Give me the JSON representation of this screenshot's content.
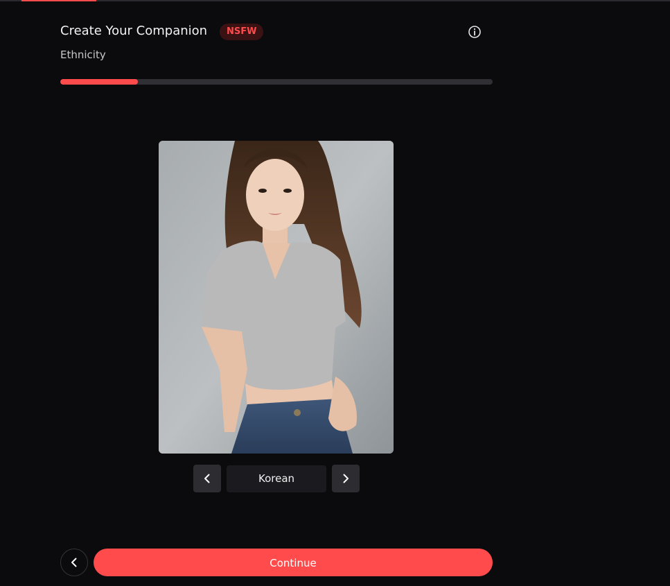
{
  "header": {
    "title": "Create Your Companion",
    "badge": "NSFW",
    "info_icon": "info-circle-icon"
  },
  "step": {
    "label": "Ethnicity",
    "progress_fraction": 0.18
  },
  "selector": {
    "current_option": "Korean",
    "prev_icon": "chevron-left-icon",
    "next_icon": "chevron-right-icon"
  },
  "footer": {
    "back_icon": "chevron-left-icon",
    "continue_label": "Continue"
  },
  "colors": {
    "accent": "#ff4b4b",
    "background": "#0b0b0d",
    "badge_background": "#3a1214",
    "track": "#2f2f34"
  }
}
